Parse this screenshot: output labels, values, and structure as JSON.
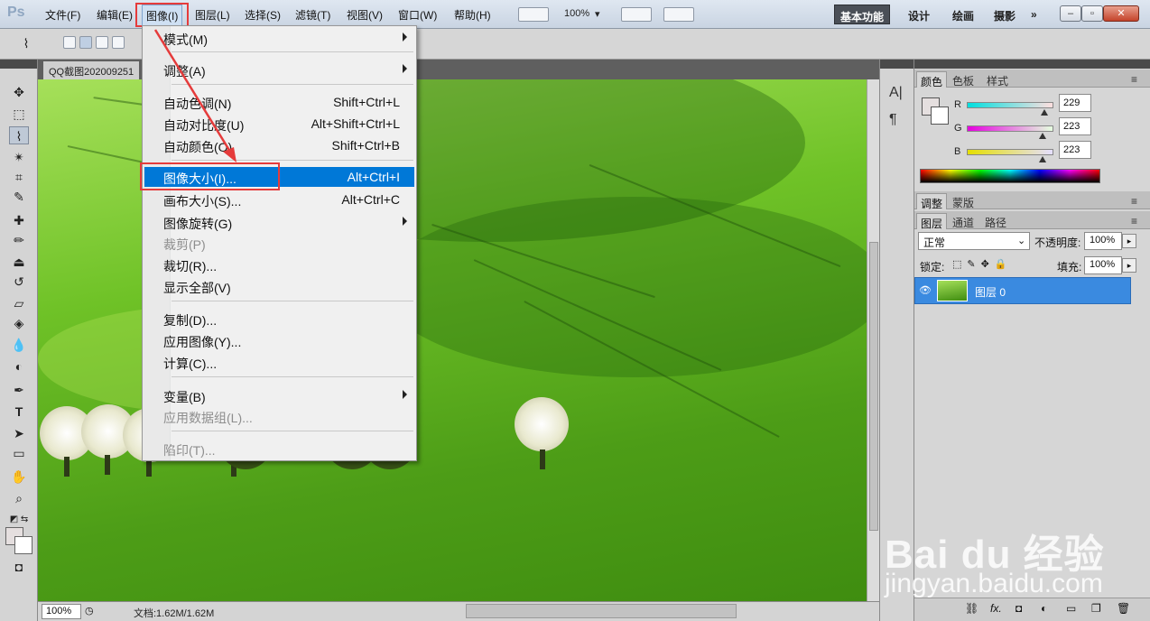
{
  "app": {
    "logo": "Ps"
  },
  "menubar": {
    "items": [
      "文件(F)",
      "编辑(E)",
      "图像(I)",
      "图层(L)",
      "选择(S)",
      "滤镜(T)",
      "视图(V)",
      "窗口(W)",
      "帮助(H)"
    ],
    "zoom": "100%",
    "workspaces": [
      "基本功能",
      "设计",
      "绘画",
      "摄影"
    ],
    "more": "»"
  },
  "document": {
    "tab_title": "QQ截图202009251",
    "zoom": "100%",
    "doc_info": "文档:1.62M/1.62M"
  },
  "image_menu": {
    "items": [
      {
        "label": "模式(M)",
        "shortcut": "",
        "submenu": true,
        "disabled": false
      },
      {
        "label": "调整(A)",
        "shortcut": "",
        "submenu": true,
        "disabled": false
      },
      {
        "label": "自动色调(N)",
        "shortcut": "Shift+Ctrl+L",
        "submenu": false,
        "disabled": false
      },
      {
        "label": "自动对比度(U)",
        "shortcut": "Alt+Shift+Ctrl+L",
        "submenu": false,
        "disabled": false
      },
      {
        "label": "自动颜色(O)",
        "shortcut": "Shift+Ctrl+B",
        "submenu": false,
        "disabled": false
      },
      {
        "label": "图像大小(I)...",
        "shortcut": "Alt+Ctrl+I",
        "submenu": false,
        "disabled": false,
        "highlighted": true
      },
      {
        "label": "画布大小(S)...",
        "shortcut": "Alt+Ctrl+C",
        "submenu": false,
        "disabled": false
      },
      {
        "label": "图像旋转(G)",
        "shortcut": "",
        "submenu": true,
        "disabled": false
      },
      {
        "label": "裁剪(P)",
        "shortcut": "",
        "submenu": false,
        "disabled": true
      },
      {
        "label": "裁切(R)...",
        "shortcut": "",
        "submenu": false,
        "disabled": false
      },
      {
        "label": "显示全部(V)",
        "shortcut": "",
        "submenu": false,
        "disabled": false
      },
      {
        "label": "复制(D)...",
        "shortcut": "",
        "submenu": false,
        "disabled": false
      },
      {
        "label": "应用图像(Y)...",
        "shortcut": "",
        "submenu": false,
        "disabled": false
      },
      {
        "label": "计算(C)...",
        "shortcut": "",
        "submenu": false,
        "disabled": false
      },
      {
        "label": "变量(B)",
        "shortcut": "",
        "submenu": true,
        "disabled": false
      },
      {
        "label": "应用数据组(L)...",
        "shortcut": "",
        "submenu": false,
        "disabled": true
      },
      {
        "label": "陷印(T)...",
        "shortcut": "",
        "submenu": false,
        "disabled": true
      }
    ]
  },
  "color_panel": {
    "tabs": [
      "颜色",
      "色板",
      "样式"
    ],
    "channels": [
      {
        "name": "R",
        "value": "229"
      },
      {
        "name": "G",
        "value": "223"
      },
      {
        "name": "B",
        "value": "223"
      }
    ],
    "foreground": "#e5dfdf",
    "background": "#ffffff"
  },
  "adjust_panel": {
    "tabs": [
      "调整",
      "蒙版"
    ]
  },
  "layers_panel": {
    "tabs": [
      "图层",
      "通道",
      "路径"
    ],
    "blend_mode": "正常",
    "opacity_label": "不透明度:",
    "opacity": "100%",
    "lock_label": "锁定:",
    "fill_label": "填充:",
    "fill": "100%",
    "layers": [
      {
        "name": "图层 0"
      }
    ],
    "footer_icons": [
      "link-icon",
      "fx-icon",
      "mask-icon",
      "adjustment-icon",
      "group-icon",
      "new-layer-icon",
      "trash-icon"
    ]
  },
  "watermark": {
    "brand": "Bai du 经验",
    "url": "jingyan.baidu.com"
  },
  "colors": {
    "accent": "#0078d7",
    "annotation": "#e53b3b"
  }
}
